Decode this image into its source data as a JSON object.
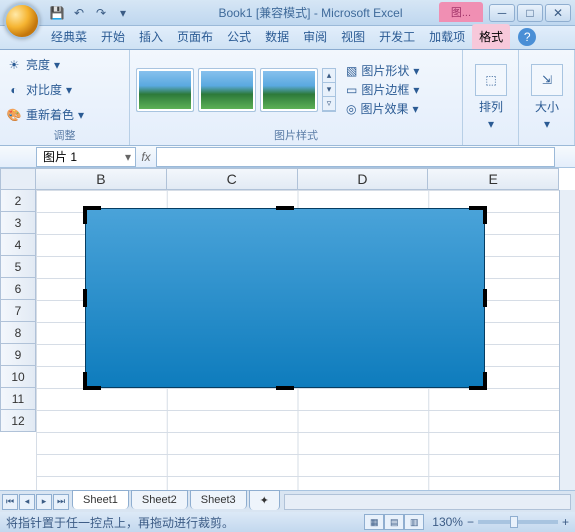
{
  "title": {
    "doc": "Book1",
    "compat": "[兼容模式]",
    "app": "Microsoft Excel",
    "context": "图..."
  },
  "tabs": {
    "classic": "经典菜",
    "home": "开始",
    "insert": "插入",
    "layout": "页面布",
    "formula": "公式",
    "data": "数据",
    "review": "审阅",
    "view": "视图",
    "dev": "开发工",
    "addin": "加载项",
    "format": "格式"
  },
  "ribbon": {
    "adjust": {
      "label": "调整",
      "brightness": "亮度",
      "contrast": "对比度",
      "recolor": "重新着色"
    },
    "styles": {
      "label": "图片样式",
      "shape": "图片形状",
      "border": "图片边框",
      "effects": "图片效果"
    },
    "arrange": {
      "label": "排列"
    },
    "size": {
      "label": "大小"
    }
  },
  "namebox": "图片 1",
  "fx": "fx",
  "cols": [
    "B",
    "C",
    "D",
    "E"
  ],
  "rows": [
    "2",
    "3",
    "4",
    "5",
    "6",
    "7",
    "8",
    "9",
    "10",
    "11",
    "12"
  ],
  "sheets": {
    "s1": "Sheet1",
    "s2": "Sheet2",
    "s3": "Sheet3"
  },
  "status": "将指针置于任一控点上，再拖动进行裁剪。",
  "zoom": {
    "pct": "130%",
    "minus": "−",
    "plus": "+"
  }
}
